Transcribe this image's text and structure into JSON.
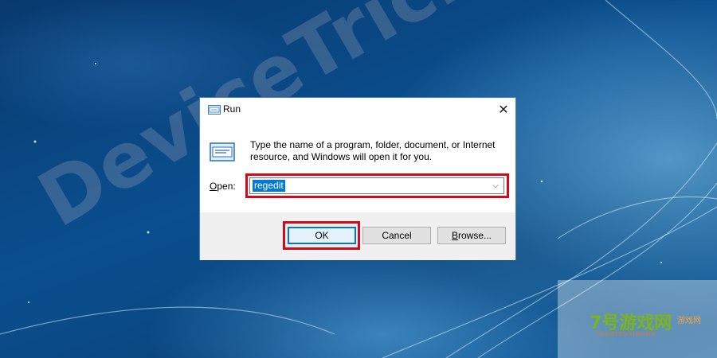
{
  "dialog": {
    "title": "Run",
    "close_glyph": "✕",
    "description": "Type the name of a program, folder, document, or Internet resource, and Windows will open it for you.",
    "open_label_accel": "O",
    "open_label_rest": "pen:",
    "input_value": "regedit",
    "dropdown_glyph": "⌵",
    "buttons": {
      "ok": "OK",
      "cancel": "Cancel",
      "browse_accel": "B",
      "browse_rest": "rowse..."
    }
  },
  "watermark": {
    "diagonal": "DeviceTricks",
    "logo": "7号游戏网",
    "subtitle": "THAOYOUXIWANG",
    "side": "游戏网"
  },
  "colors": {
    "accent": "#0078d7",
    "highlight_box": "#d20a1e"
  },
  "icons": [
    "run-app-icon",
    "run-large-icon",
    "close-icon",
    "chevron-down-icon"
  ]
}
